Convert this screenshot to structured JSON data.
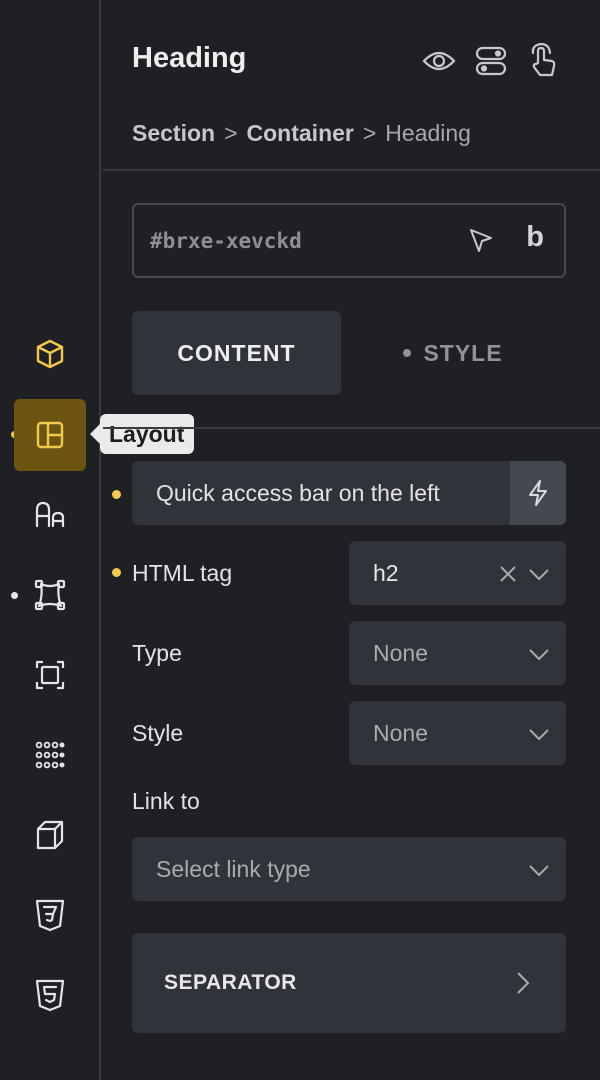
{
  "colors": {
    "background": "#1e2024",
    "accent_yellow": "#f2c94c",
    "active_rail_bg": "#6b5511",
    "control_bg": "#30343a"
  },
  "rail": {
    "items": [
      {
        "name": "element-cube-icon",
        "active": false,
        "dot": false
      },
      {
        "name": "layout-icon",
        "active": true,
        "dot": true
      },
      {
        "name": "typography-icon",
        "active": false,
        "dot": false
      },
      {
        "name": "spacing-icon",
        "active": false,
        "dot": true
      },
      {
        "name": "frame-icon",
        "active": false,
        "dot": false
      },
      {
        "name": "grid-dots-icon",
        "active": false,
        "dot": false
      },
      {
        "name": "transform-cube-icon",
        "active": false,
        "dot": false
      },
      {
        "name": "css3-icon",
        "active": false,
        "dot": false
      },
      {
        "name": "html5-icon",
        "active": false,
        "dot": false
      }
    ],
    "tooltip": "Layout"
  },
  "header": {
    "title": "Heading",
    "icons": [
      "eye-icon",
      "toggle-icon",
      "pointer-hand-icon"
    ]
  },
  "breadcrumb": {
    "items": [
      "Section",
      "Container",
      "Heading"
    ],
    "separator": ">"
  },
  "id_field": {
    "value": "#brxe-xevckd",
    "icons": [
      "cursor-select-icon",
      "b-icon"
    ],
    "b_label": "b"
  },
  "tabs": [
    {
      "label": "CONTENT",
      "active": true
    },
    {
      "label": "STYLE",
      "active": false
    }
  ],
  "quick_access": {
    "label": "Quick access bar on the left",
    "icon": "bolt-icon"
  },
  "fields": {
    "html_tag": {
      "label": "HTML tag",
      "value": "h2"
    },
    "type": {
      "label": "Type",
      "value": "None"
    },
    "style": {
      "label": "Style",
      "value": "None"
    },
    "link_to": {
      "label": "Link to",
      "placeholder": "Select link type"
    }
  },
  "separator": {
    "label": "SEPARATOR"
  }
}
